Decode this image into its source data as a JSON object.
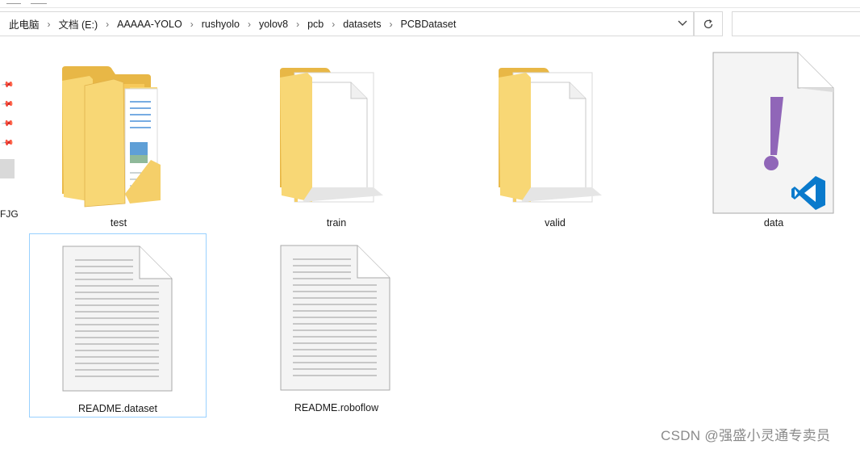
{
  "address_bar": {
    "crumbs": [
      "此电脑",
      "文档 (E:)",
      "AAAAA-YOLO",
      "rushyolo",
      "yolov8",
      "pcb",
      "datasets",
      "PCBDataset"
    ],
    "separator": "›",
    "dropdown_icon": "chevron-down-icon",
    "refresh_icon": "refresh-icon"
  },
  "nav_pane": {
    "pins": [
      "pin-icon",
      "pin-icon",
      "pin-icon",
      "pin-icon"
    ],
    "partial_label": "FJG"
  },
  "items": [
    {
      "name": "test",
      "icon": "folder-with-documents-icon",
      "selected": false
    },
    {
      "name": "train",
      "icon": "folder-with-document-icon",
      "selected": false
    },
    {
      "name": "valid",
      "icon": "folder-with-document-icon",
      "selected": false
    },
    {
      "name": "data",
      "icon": "yaml-vscode-file-icon",
      "selected": false
    },
    {
      "name": "README.dataset",
      "icon": "text-file-icon",
      "selected": true
    },
    {
      "name": "README.roboflow",
      "icon": "text-file-icon",
      "selected": false
    }
  ],
  "watermark": "CSDN @强盛小灵通专卖员",
  "colors": {
    "folder": "#f8d775",
    "folder_dark": "#e8b746",
    "selection_border": "#99d1ff",
    "vscode_blue": "#0a7acc",
    "yaml_exclaim": "#9066b8"
  }
}
